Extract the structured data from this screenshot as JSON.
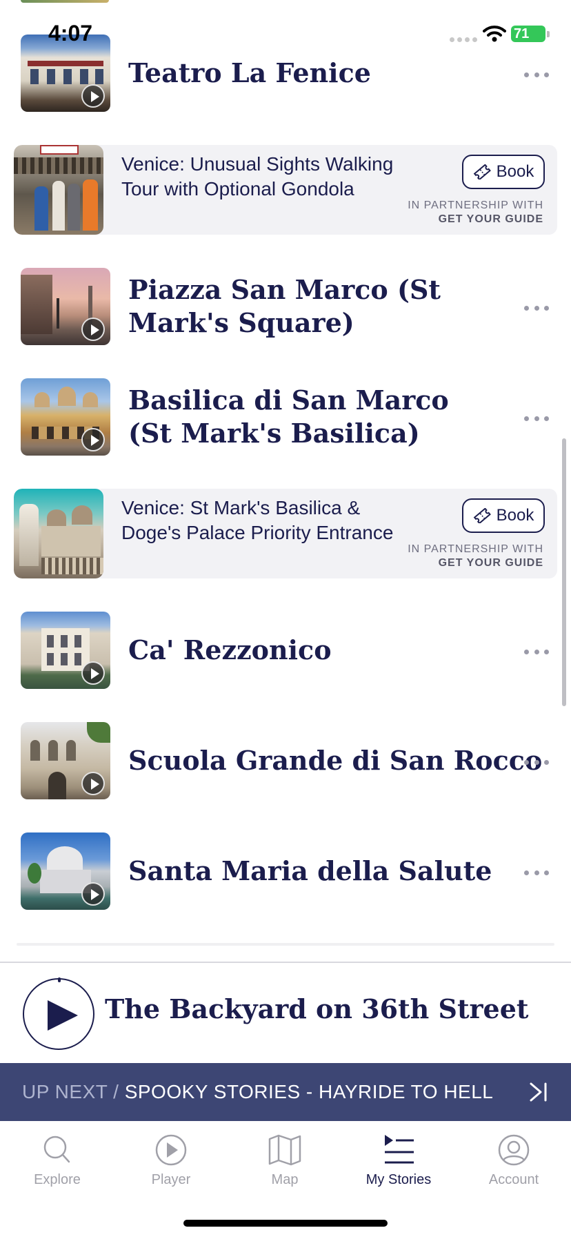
{
  "status_bar": {
    "time": "4:07",
    "battery": "71"
  },
  "stories": [
    {
      "title": "Teatro La Fenice"
    },
    {
      "title": "Piazza San Marco (St Mark's Square)"
    },
    {
      "title": "Basilica di San Marco (St Mark's Basilica)"
    },
    {
      "title": "Ca' Rezzonico"
    },
    {
      "title": "Scuola Grande di San Rocco"
    },
    {
      "title": "Santa Maria della Salute"
    }
  ],
  "ads": [
    {
      "title": "Venice: Unusual Sights Walking Tour with Optional Gondola",
      "book_label": "Book",
      "partner_label": "IN PARTNERSHIP WITH",
      "partner_brand": "GET YOUR GUIDE"
    },
    {
      "title": "Venice: St Mark's Basilica & Doge's Palace Priority Entrance",
      "book_label": "Book",
      "partner_label": "IN PARTNERSHIP WITH",
      "partner_brand": "GET YOUR GUIDE"
    }
  ],
  "now_playing": {
    "title": "The Backyard on 36th Street"
  },
  "up_next": {
    "label": "UP NEXT /",
    "title": "SPOOKY STORIES - HAYRIDE TO HELL"
  },
  "tabs": [
    {
      "label": "Explore",
      "icon": "search-icon",
      "active": false
    },
    {
      "label": "Player",
      "icon": "play-circle-icon",
      "active": false
    },
    {
      "label": "Map",
      "icon": "map-icon",
      "active": false
    },
    {
      "label": "My Stories",
      "icon": "playlist-icon",
      "active": true
    },
    {
      "label": "Account",
      "icon": "account-icon",
      "active": false
    }
  ],
  "colors": {
    "navy": "#1b1d4d",
    "up_next_bar": "#3d4674",
    "battery": "#34c759",
    "ad_background": "#f2f2f5"
  }
}
